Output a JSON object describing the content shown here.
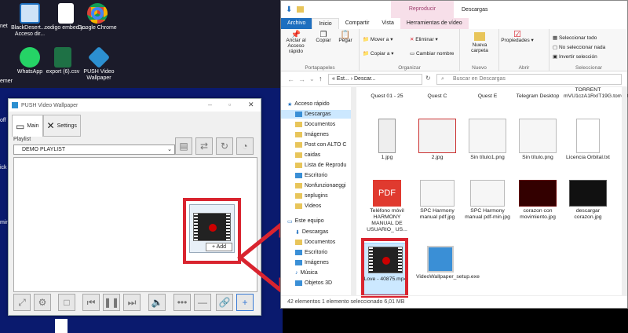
{
  "desktop": {
    "icons": [
      {
        "label": "BlackDesert... - Acceso dir..."
      },
      {
        "label": "codigo embed y..."
      },
      {
        "label": "Google Chrome"
      },
      {
        "label": "WhatsApp"
      },
      {
        "label": "export (6).csv"
      },
      {
        "label": "PUSH Video Wallpaper"
      }
    ],
    "edge_labels": [
      "net",
      "emer",
      "off",
      "ick",
      "min",
      "e"
    ]
  },
  "push": {
    "title": "PUSH Video Wallpaper",
    "tab_main": "Main",
    "tab_settings": "Settings",
    "playlist_label": "Playlist",
    "playlist_value": "DEMO PLAYLIST",
    "add_label": "+ Add"
  },
  "explorer": {
    "title": "Descargas",
    "context_tab": "Reproducir",
    "ribbon_tabs": [
      "Archivo",
      "Inicio",
      "Compartir",
      "Vista",
      "Herramientas de vídeo"
    ],
    "ribbon": {
      "pin": "Anclar al Acceso rápido",
      "copy": "Copiar",
      "paste": "Pegar",
      "move_to": "Mover a",
      "copy_to": "Copiar a",
      "delete": "Eliminar",
      "rename": "Cambiar nombre",
      "new_folder": "Nueva carpeta",
      "properties": "Propiedades",
      "select_all": "Seleccionar todo",
      "select_none": "No seleccionar nada",
      "invert": "Invertir selección",
      "g_clipboard": "Portapapeles",
      "g_organize": "Organizar",
      "g_new": "Nuevo",
      "g_open": "Abrir",
      "g_select": "Seleccionar"
    },
    "address": "« Est... › Descar...",
    "search_placeholder": "Buscar en Descargas",
    "nav": [
      "Acceso rápido",
      "Descargas",
      "Documentos",
      "Imágenes",
      "Post con ALTO C",
      "caidas",
      "Lista de Reprodu",
      "Escritorio",
      "Nonfunzionaeggi",
      "seplugins",
      "Videos",
      "Este equipo",
      "Descargas",
      "Documentos",
      "Escritorio",
      "Imágenes",
      "Música",
      "Objetos 3D"
    ],
    "files": [
      {
        "name": "Quest 01 - 25"
      },
      {
        "name": "Quest C"
      },
      {
        "name": "Quest E"
      },
      {
        "name": "Telegram Desktop"
      },
      {
        "name": "TORRENT mVU1czA1RxIT19G.torrent"
      },
      {
        "name": "1.jpg"
      },
      {
        "name": "2.jpg"
      },
      {
        "name": "Sin título1.png"
      },
      {
        "name": "Sin título.png"
      },
      {
        "name": "Licencia Orbital.txt"
      },
      {
        "name": "Teléfono móvil HARMONY MANUAL DE USUARIO_ US..."
      },
      {
        "name": "SPC Harmony manual pdf.jpg"
      },
      {
        "name": "SPC Harmony manual pdf-min.jpg"
      },
      {
        "name": "corazon con movimiento.jpg"
      },
      {
        "name": "descargar corazon.jpg"
      },
      {
        "name": "Love - 40875.mp4"
      },
      {
        "name": "VideoWallpaper_setup.exe"
      }
    ],
    "status": "42 elementos     1 elemento seleccionado  6,01 MB"
  },
  "colors": {
    "accent_red": "#d9242f",
    "desktop_blue": "#0a1a6e",
    "selection": "#cce8ff"
  }
}
